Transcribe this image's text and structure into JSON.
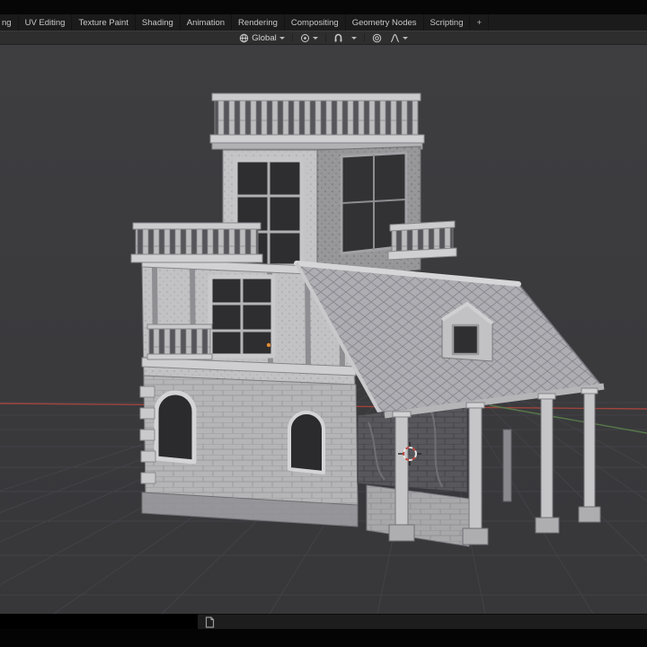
{
  "topbar": {
    "tabs": [
      "ng",
      "UV Editing",
      "Texture Paint",
      "Shading",
      "Animation",
      "Rendering",
      "Compositing",
      "Geometry Nodes",
      "Scripting"
    ],
    "add_tab": "+"
  },
  "viewport_header": {
    "orientation": "Global",
    "icons": [
      "orientation-globe-icon",
      "pivot-point-icon",
      "magnet-snap-icon",
      "proportional-editing-icon",
      "falloff-curve-icon"
    ]
  },
  "viewport": {
    "content": "medieval stone-and-timber house 3D model, solid matcap shading",
    "background": "#3b3b3d",
    "axis_x_color": "#a0443e",
    "axis_y_color": "#57784a",
    "cursor": "3d-cursor",
    "origin_color": "#de8d3c"
  },
  "bottom": {
    "editor_icon": "document-editor-type-icon"
  }
}
